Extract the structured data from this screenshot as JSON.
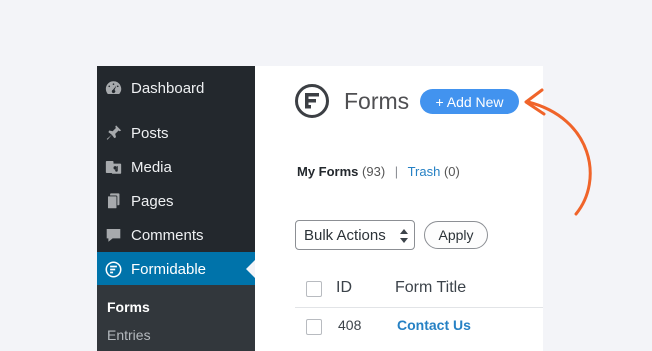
{
  "sidebar": {
    "items": [
      {
        "label": "Dashboard",
        "icon": "dashboard-icon"
      },
      {
        "label": "Posts",
        "icon": "pin-icon"
      },
      {
        "label": "Media",
        "icon": "media-icon"
      },
      {
        "label": "Pages",
        "icon": "pages-icon"
      },
      {
        "label": "Comments",
        "icon": "comment-icon"
      },
      {
        "label": "Formidable",
        "icon": "formidable-icon",
        "active": true
      }
    ],
    "submenu": [
      {
        "label": "Forms",
        "current": true
      },
      {
        "label": "Entries"
      }
    ]
  },
  "header": {
    "title": "Forms",
    "add_new_label": "+ Add New"
  },
  "views": {
    "my_forms_label": "My Forms",
    "my_forms_count": "(93)",
    "separator": "|",
    "trash_label": "Trash",
    "trash_count": "(0)"
  },
  "bulk": {
    "selected": "Bulk Actions",
    "apply_label": "Apply"
  },
  "table": {
    "columns": [
      "ID",
      "Form Title"
    ],
    "rows": [
      {
        "id": "408",
        "title": "Contact Us"
      }
    ]
  },
  "colors": {
    "sidebar_bg": "#23282d",
    "active_bg": "#0073aa",
    "add_new_bg": "#4293ef",
    "link": "#2681c4",
    "annotation_arrow": "#f0642a"
  }
}
